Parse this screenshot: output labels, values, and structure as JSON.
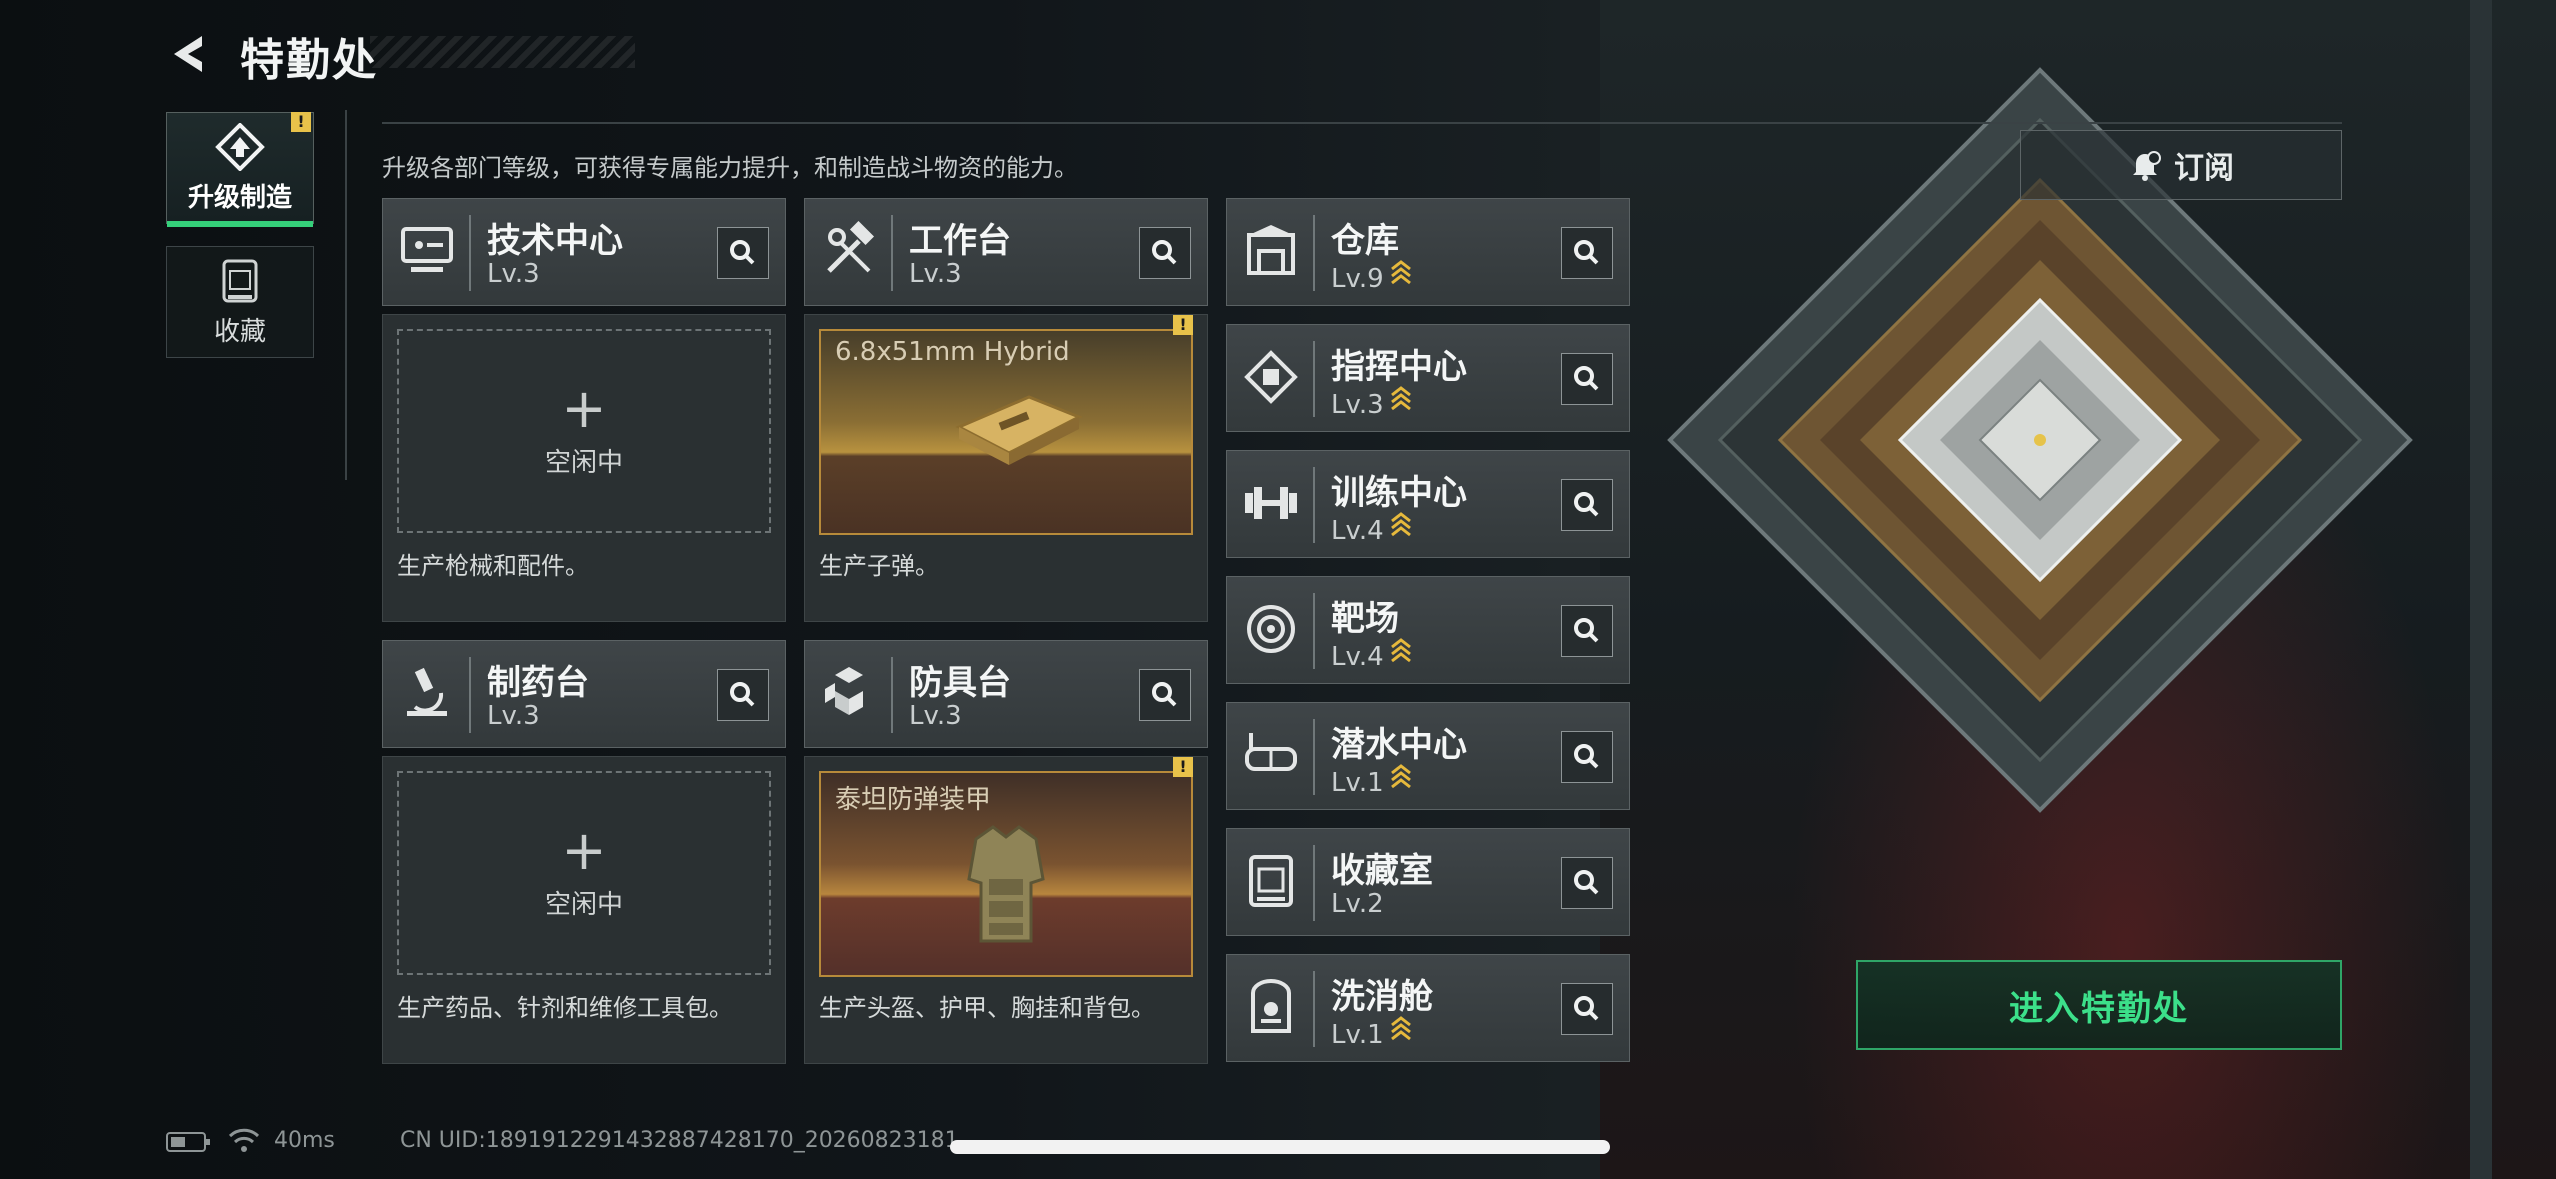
{
  "header": {
    "title": "特勤处"
  },
  "sidebar": {
    "tabs": [
      {
        "label": "升级制造",
        "active": true,
        "alert": "!"
      },
      {
        "label": "收藏",
        "active": false
      }
    ]
  },
  "subtitle": "升级各部门等级，可获得专属能力提升，和制造战斗物资的能力。",
  "departments_left": [
    {
      "name": "技术中心",
      "level": "Lv.3",
      "icon": "computer-icon",
      "slot": {
        "state": "idle",
        "plus": "+",
        "status": "空闲中"
      },
      "desc": "生产枪械和配件。"
    },
    {
      "name": "工作台",
      "level": "Lv.3",
      "icon": "tools-icon",
      "slot": {
        "state": "producing",
        "item": "6.8x51mm Hybrid",
        "alert": "!"
      },
      "desc": "生产子弹。"
    },
    {
      "name": "制药台",
      "level": "Lv.3",
      "icon": "microscope-icon",
      "slot": {
        "state": "idle",
        "plus": "+",
        "status": "空闲中"
      },
      "desc": "生产药品、针剂和维修工具包。"
    },
    {
      "name": "防具台",
      "level": "Lv.3",
      "icon": "cubes-icon",
      "slot": {
        "state": "producing",
        "item": "泰坦防弹装甲",
        "alert": "!"
      },
      "desc": "生产头盔、护甲、胸挂和背包。"
    }
  ],
  "departments_right": [
    {
      "name": "仓库",
      "level": "Lv.9",
      "upgrade": "≈",
      "icon": "warehouse-icon"
    },
    {
      "name": "指挥中心",
      "level": "Lv.3",
      "upgrade": "≈",
      "icon": "chip-icon"
    },
    {
      "name": "训练中心",
      "level": "Lv.4",
      "upgrade": "≈",
      "icon": "dumbbell-icon"
    },
    {
      "name": "靶场",
      "level": "Lv.4",
      "upgrade": "≈",
      "icon": "target-icon"
    },
    {
      "name": "潜水中心",
      "level": "Lv.1",
      "upgrade": "≈",
      "icon": "diving-mask-icon"
    },
    {
      "name": "收藏室",
      "level": "Lv.2",
      "upgrade": "",
      "icon": "trophy-case-icon"
    },
    {
      "name": "洗消舱",
      "level": "Lv.1",
      "upgrade": "≈",
      "icon": "decon-pod-icon"
    }
  ],
  "subscribe": {
    "label": "订阅"
  },
  "enter": {
    "label": "进入特勤处"
  },
  "status_bar": {
    "ping": "40ms",
    "uid": "CN UID:1891912291432887428170_20260823181"
  },
  "colors": {
    "accent_green": "#35d07a",
    "upgrade_gold": "#e6b93c",
    "warning": "#e8c24a"
  }
}
